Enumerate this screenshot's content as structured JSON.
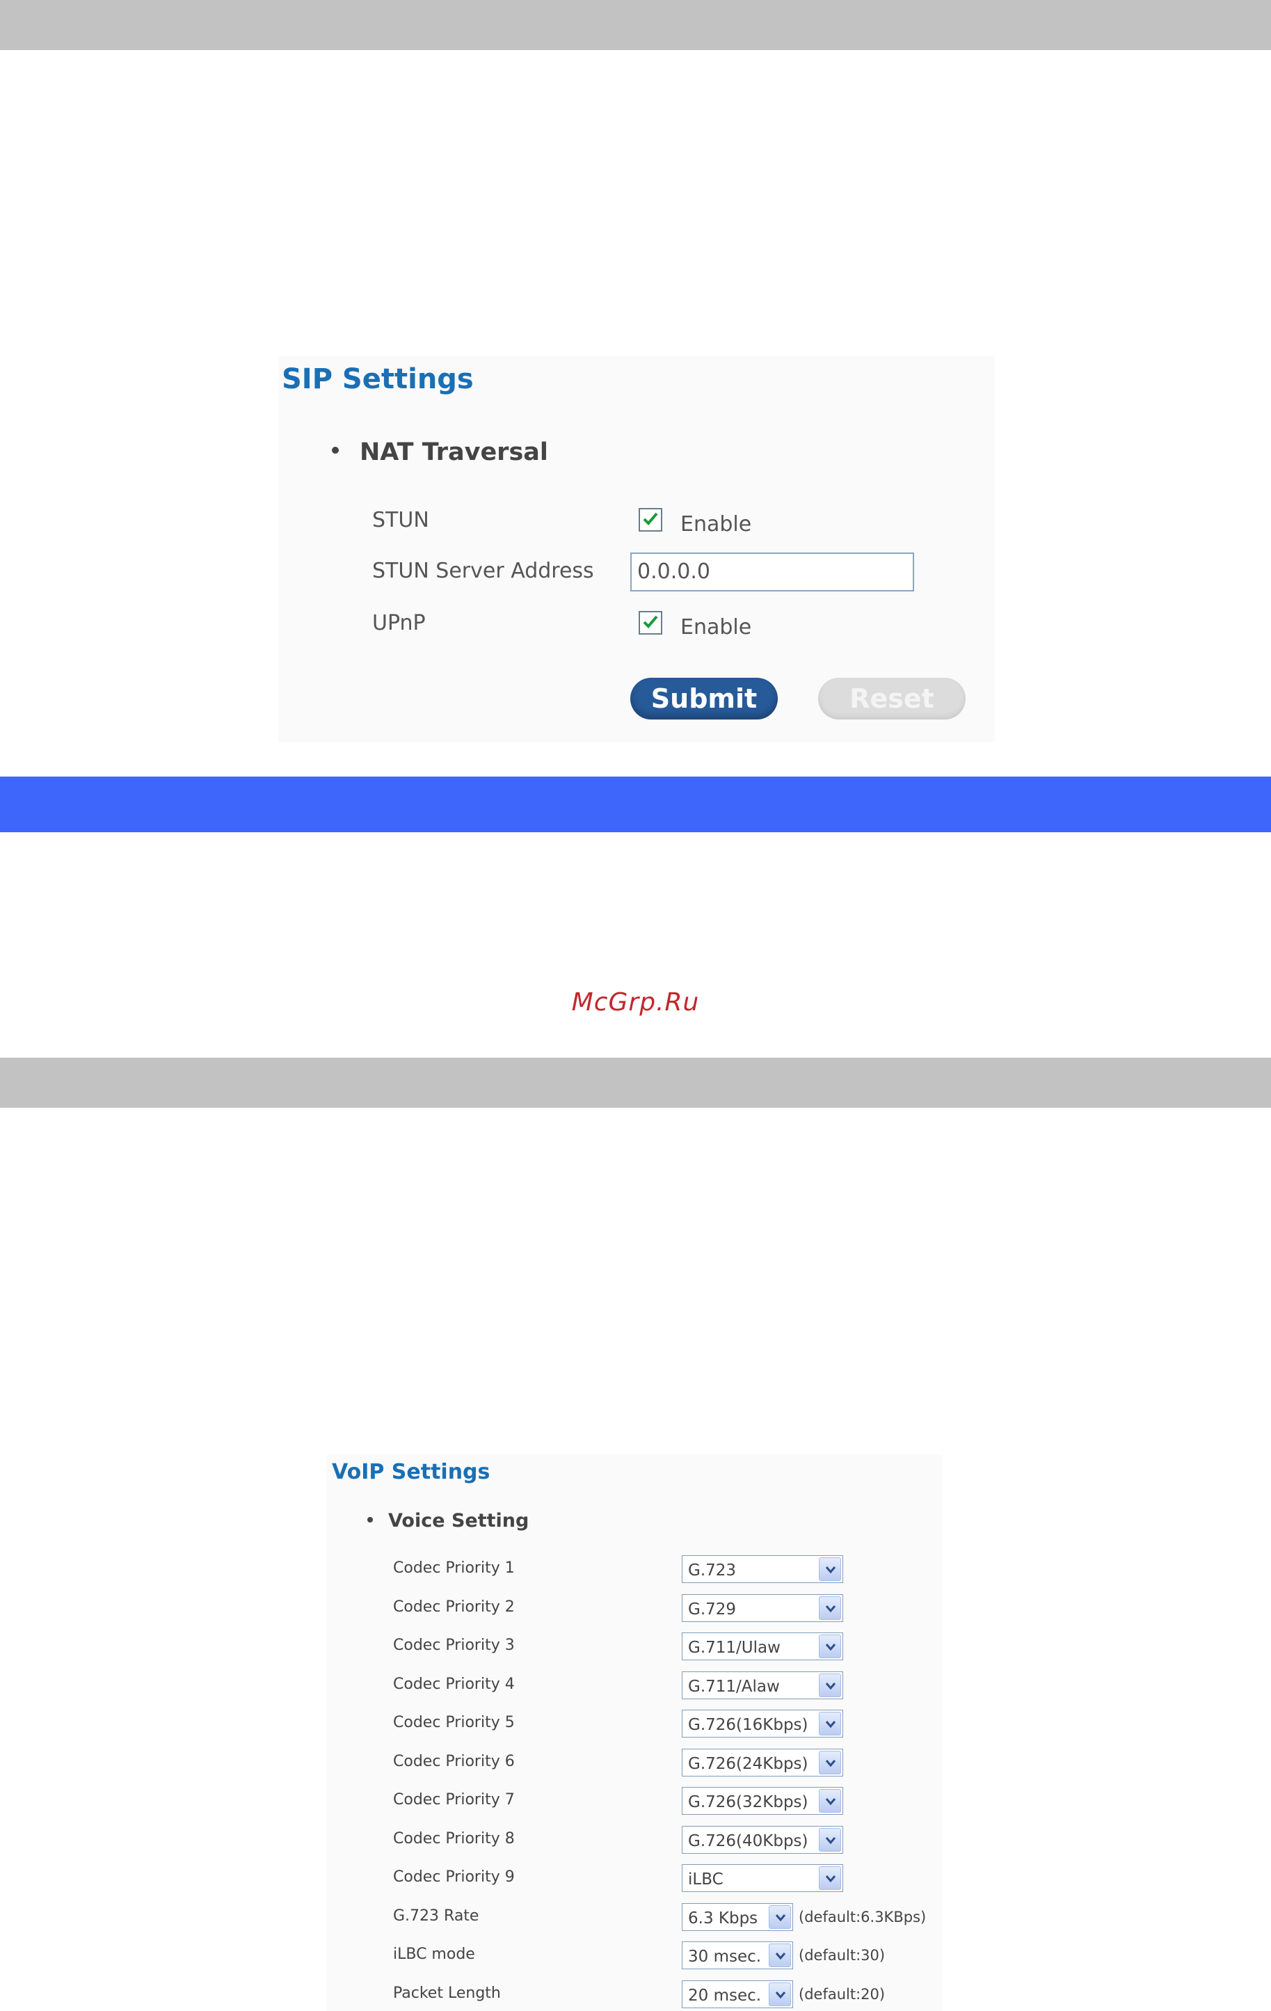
{
  "watermark": "McGrp.Ru",
  "sip": {
    "title": "SIP Settings",
    "section": "NAT Traversal",
    "stun_label": "STUN",
    "stun_enable_label": "Enable",
    "stun_enabled": true,
    "stun_server_label": "STUN Server Address",
    "stun_server_value": "0.0.0.0",
    "upnp_label": "UPnP",
    "upnp_enable_label": "Enable",
    "upnp_enabled": true,
    "submit_label": "Submit",
    "reset_label": "Reset"
  },
  "voip": {
    "title": "VoIP Settings",
    "section": "Voice Setting",
    "rows": [
      {
        "label": "Codec Priority 1",
        "value": "G.723",
        "note": ""
      },
      {
        "label": "Codec Priority 2",
        "value": "G.729",
        "note": ""
      },
      {
        "label": "Codec Priority 3",
        "value": "G.711/Ulaw",
        "note": ""
      },
      {
        "label": "Codec Priority 4",
        "value": "G.711/Alaw",
        "note": ""
      },
      {
        "label": "Codec Priority 5",
        "value": "G.726(16Kbps)",
        "note": ""
      },
      {
        "label": "Codec Priority 6",
        "value": "G.726(24Kbps)",
        "note": ""
      },
      {
        "label": "Codec Priority 7",
        "value": "G.726(32Kbps)",
        "note": ""
      },
      {
        "label": "Codec Priority 8",
        "value": "G.726(40Kbps)",
        "note": ""
      },
      {
        "label": "Codec Priority 9",
        "value": "iLBC",
        "note": ""
      },
      {
        "label": "G.723 Rate",
        "value": "6.3 Kbps",
        "note": "(default:6.3KBps)"
      },
      {
        "label": "iLBC mode",
        "value": "30 msec.",
        "note": "(default:30)"
      },
      {
        "label": "Packet Length",
        "value": "20 msec.",
        "note": "(default:20)"
      }
    ]
  }
}
